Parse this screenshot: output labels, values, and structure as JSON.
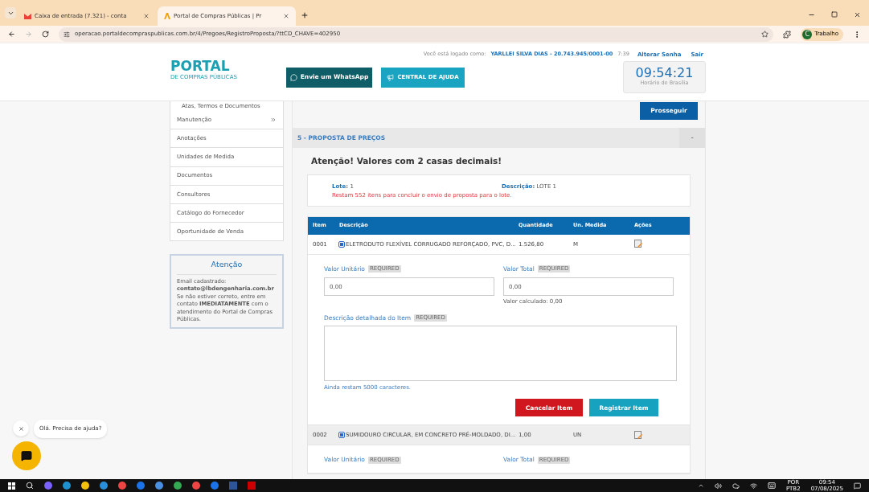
{
  "browser": {
    "tabs": [
      {
        "title": "Caixa de entrada (7.321) - conta",
        "selected": false
      },
      {
        "title": "Portal de Compras Públicas | Pr",
        "selected": true
      }
    ],
    "url": "operacao.portaldecompraspublicas.com.br/4/Pregoes/RegistroProposta/?ttCD_CHAVE=402950",
    "profile_initial": "C",
    "profile": "Trabalho"
  },
  "header": {
    "logo_title": "PORTAL",
    "logo_subtitle": "DE COMPRAS PÚBLICAS",
    "whatsapp": "Envie um WhatsApp",
    "help": "CENTRAL DE AJUDA",
    "login_label": "Você está logado como:",
    "user": "YARLLEI SILVA DIAS - 20.743.945/0001-00",
    "session": "7:39",
    "change_password": "Alterar Senha",
    "logout": "Sair",
    "clock": "09:54:21",
    "clock_label": "Horário de Brasília"
  },
  "sidebar": {
    "subitem": "Atas, Termos e Documentos",
    "items": [
      {
        "label": "Manutenção",
        "expandable": true
      },
      {
        "label": "Anotações",
        "expandable": false
      },
      {
        "label": "Unidades de Medida",
        "expandable": false
      },
      {
        "label": "Documentos",
        "expandable": false
      },
      {
        "label": "Consultores",
        "expandable": false
      },
      {
        "label": "Catálogo do Fornecedor",
        "expandable": false
      },
      {
        "label": "Oportunidade de Venda",
        "expandable": false
      }
    ],
    "notice": {
      "title": "Atenção",
      "text": "Email cadastrado: **contato@lbdengenharia.com.br** Se não estiver correto, entre em contato **IMEDIATAMENTE** com o atendimento do Portal de Compras Públicas."
    }
  },
  "main": {
    "continue": "Prosseguir",
    "section": "5 - PROPOSTA DE PREÇOS",
    "collapse": "-",
    "warning": "Atenção! Valores com 2 casas decimais!",
    "lot_label": "Lote:",
    "lot": "1",
    "desc_label": "Descrição:",
    "desc": "LOTE 1",
    "remaining": "Restam 552 itens para concluir o envio de proposta para o lote.",
    "table": {
      "columns": [
        "Item",
        "Descrição",
        "Quantidade",
        "Un. Medida",
        "Ações"
      ],
      "rows": [
        {
          "item": "0001",
          "description": "ELETRODUTO FLEXÍVEL CORRUGADO REFORÇADO, PVC, D...",
          "quantity": "1.526,80",
          "unit": "M",
          "expanded": true,
          "form": {
            "unit_label": "Valor Unitário",
            "unit_required": "REQUIRED",
            "total_label": "Valor Total",
            "total_required": "REQUIRED",
            "detail_required": "REQUIRED",
            "unit_value": "0,00",
            "total_value": "0,00",
            "calculated": "Valor calculado: 0,00",
            "detail_label": "Descrição detalhada do Item",
            "chars_left": "Ainda restam 5000 caracteres.",
            "cancel": "Cancelar Item",
            "register": "Registrar Item"
          }
        },
        {
          "item": "0002",
          "description": "SUMIDOURO CIRCULAR, EM CONCRETO PRÉ-MOLDADO, DI...",
          "quantity": "1,00",
          "unit": "UN",
          "expanded": true,
          "form": {
            "unit_label": "Valor Unitário",
            "unit_required": "REQUIRED",
            "total_label": "Valor Total",
            "total_required": "REQUIRED"
          }
        }
      ]
    }
  },
  "chat": {
    "greeting": "Olá. Precisa de ajuda?"
  },
  "taskbar": {
    "language": "POR",
    "layout": "PTB2",
    "time": "09:54",
    "date": "07/08/2025"
  }
}
